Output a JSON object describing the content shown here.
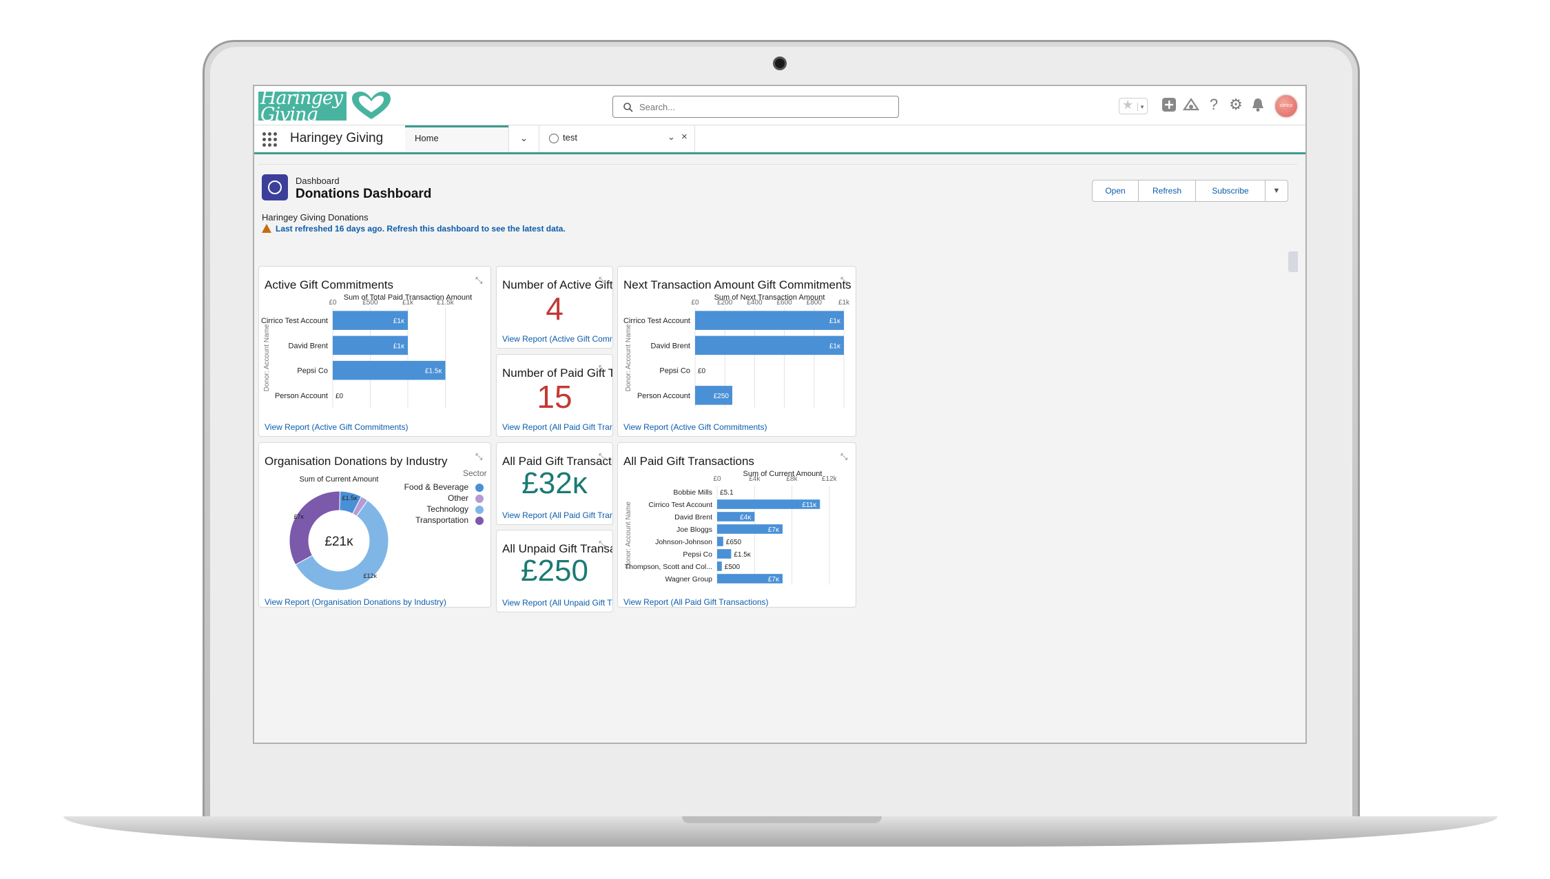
{
  "app": {
    "logo_text": "Haringey Giving",
    "name": "Haringey Giving",
    "search_placeholder": "Search...",
    "avatar_text": "cirrico"
  },
  "header_icons": [
    "favorites-star-icon",
    "add-icon",
    "trailhead-icon",
    "help-icon",
    "setup-gear-icon",
    "notifications-bell-icon"
  ],
  "nav": {
    "tabs": [
      {
        "label": "Home",
        "active": true
      },
      {
        "label": "test",
        "active": false
      }
    ]
  },
  "dashboard": {
    "kind": "Dashboard",
    "title": "Donations Dashboard",
    "subtitle": "Haringey Giving Donations",
    "warning": "Last refreshed 16 days ago. Refresh this dashboard to see the latest data.",
    "buttons": {
      "open": "Open",
      "refresh": "Refresh",
      "subscribe": "Subscribe"
    }
  },
  "colors": {
    "bar": "#4a90d6",
    "accent": "#3d9b8f",
    "metric_red": "#c23934",
    "metric_teal": "#1b7a73",
    "link": "#0b5cab"
  },
  "panels": {
    "active_gift": {
      "title": "Active Gift Commitments",
      "link": "View Report (Active Gift Commitments)"
    },
    "num_active": {
      "title": "Number of Active Gift ...",
      "value": "4",
      "link": "View Report (Active Gift Commitme..."
    },
    "num_paid": {
      "title": "Number of Paid Gift Tr...",
      "value": "15",
      "link": "View Report (All Paid Gift Transacti..."
    },
    "next_txn": {
      "title": "Next Transaction Amount Gift Commitments",
      "link": "View Report (Active Gift Commitments)"
    },
    "org_donations": {
      "title": "Organisation Donations by Industry",
      "link": "View Report (Organisation Donations by Industry)"
    },
    "all_paid_metric": {
      "title": "All Paid Gift Transactions",
      "value": "£32ĸ",
      "link": "View Report (All Paid Gift Transacti..."
    },
    "all_unpaid_metric": {
      "title": "All Unpaid Gift Transac...",
      "value": "£250",
      "link": "View Report (All Unpaid Gift Transa..."
    },
    "all_paid_chart": {
      "title": "All Paid Gift Transactions",
      "link": "View Report (All Paid Gift Transactions)"
    }
  },
  "chart_data": [
    {
      "id": "active_gift",
      "type": "bar",
      "orientation": "horizontal",
      "title": "Sum of Total Paid Transaction Amount",
      "ylabel": "Donor: Account Name",
      "xlim": [
        0,
        2000
      ],
      "ticks": [
        {
          "value": 0,
          "label": "£0"
        },
        {
          "value": 500,
          "label": "£500"
        },
        {
          "value": 1000,
          "label": "£1k"
        },
        {
          "value": 1500,
          "label": "£1.5k"
        }
      ],
      "categories": [
        "Cirrico Test Account",
        "David Brent",
        "Pepsi Co",
        "Person Account"
      ],
      "values": [
        1000,
        1000,
        1500,
        0
      ],
      "data_labels": [
        "£1ĸ",
        "£1ĸ",
        "£1.5ĸ",
        "£0"
      ]
    },
    {
      "id": "next_txn",
      "type": "bar",
      "orientation": "horizontal",
      "title": "Sum of Next Transaction Amount",
      "ylabel": "Donor: Account Name",
      "xlim": [
        0,
        1000
      ],
      "ticks": [
        {
          "value": 0,
          "label": "£0"
        },
        {
          "value": 200,
          "label": "£200"
        },
        {
          "value": 400,
          "label": "£400"
        },
        {
          "value": 600,
          "label": "£600"
        },
        {
          "value": 800,
          "label": "£800"
        },
        {
          "value": 1000,
          "label": "£1k"
        }
      ],
      "categories": [
        "Cirrico Test Account",
        "David Brent",
        "Pepsi Co",
        "Person Account"
      ],
      "values": [
        1000,
        1000,
        0,
        250
      ],
      "data_labels": [
        "£1ĸ",
        "£1ĸ",
        "£0",
        "£250"
      ]
    },
    {
      "id": "org_donations",
      "type": "pie",
      "donut": true,
      "title": "Sum of Current Amount",
      "center_label": "£21ĸ",
      "legend_title": "Sector",
      "slices": [
        {
          "label": "Food & Beverage",
          "value": 1500,
          "data_label": "£1.5ĸ",
          "color": "#4a90d6"
        },
        {
          "label": "Other",
          "value": 500,
          "data_label": "",
          "color": "#b59ad4"
        },
        {
          "label": "Technology",
          "value": 12000,
          "data_label": "£12ĸ",
          "color": "#7fb6e6"
        },
        {
          "label": "Transportation",
          "value": 7000,
          "data_label": "£7ĸ",
          "color": "#7b59ab"
        }
      ],
      "legend_order": [
        "Food & Beverage",
        "Other",
        "Technology",
        "Transportation"
      ]
    },
    {
      "id": "all_paid_chart",
      "type": "bar",
      "orientation": "horizontal",
      "title": "Sum of Current Amount",
      "ylabel": "Donor: Account Name",
      "xlim": [
        0,
        14000
      ],
      "ticks": [
        {
          "value": 0,
          "label": "£0"
        },
        {
          "value": 4000,
          "label": "£4k"
        },
        {
          "value": 8000,
          "label": "£8k"
        },
        {
          "value": 12000,
          "label": "£12k"
        }
      ],
      "categories": [
        "Bobbie Mills",
        "Cirrico Test Account",
        "David Brent",
        "Joe Bloggs",
        "Johnson-Johnson",
        "Pepsi Co",
        "Thompson, Scott and Col...",
        "Wagner Group"
      ],
      "values": [
        5.1,
        11000,
        4000,
        7000,
        650,
        1500,
        500,
        7000
      ],
      "data_labels": [
        "£5.1",
        "£11ĸ",
        "£4ĸ",
        "£7ĸ",
        "£650",
        "£1.5ĸ",
        "£500",
        "£7ĸ"
      ]
    }
  ]
}
